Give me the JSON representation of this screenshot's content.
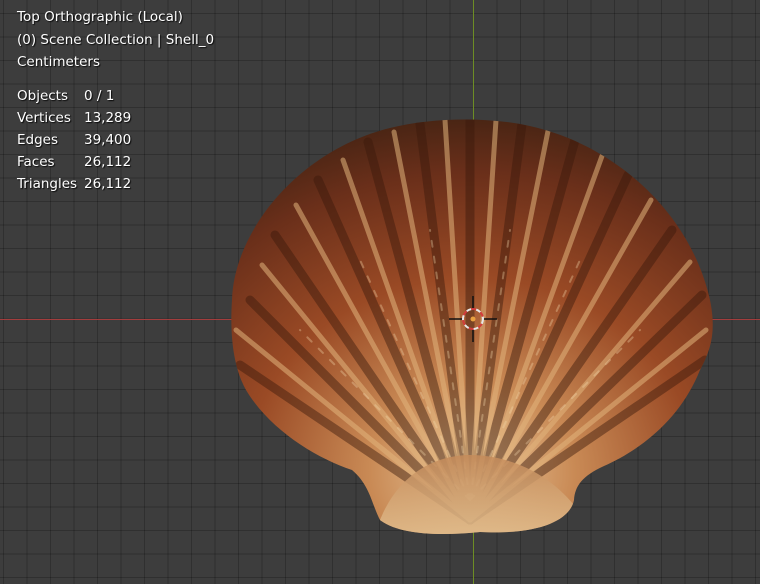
{
  "viewport": {
    "view_name": "Top Orthographic (Local)",
    "collection": "(0) Scene Collection | Shell_0",
    "units": "Centimeters"
  },
  "stats": [
    {
      "label": "Objects",
      "value": "0 / 1"
    },
    {
      "label": "Vertices",
      "value": "13,289"
    },
    {
      "label": "Edges",
      "value": "39,400"
    },
    {
      "label": "Faces",
      "value": "26,112"
    },
    {
      "label": "Triangles",
      "value": "26,112"
    }
  ],
  "colors": {
    "background": "#3d3d3d",
    "x_axis": "#a33d3d",
    "y_axis": "#6d8d24",
    "cursor_ring": "#e8e8e8",
    "cursor_ring_alt": "#d23c3c"
  },
  "icons": {
    "cursor": "3d-cursor-icon",
    "object": "scallop-shell-mesh"
  }
}
